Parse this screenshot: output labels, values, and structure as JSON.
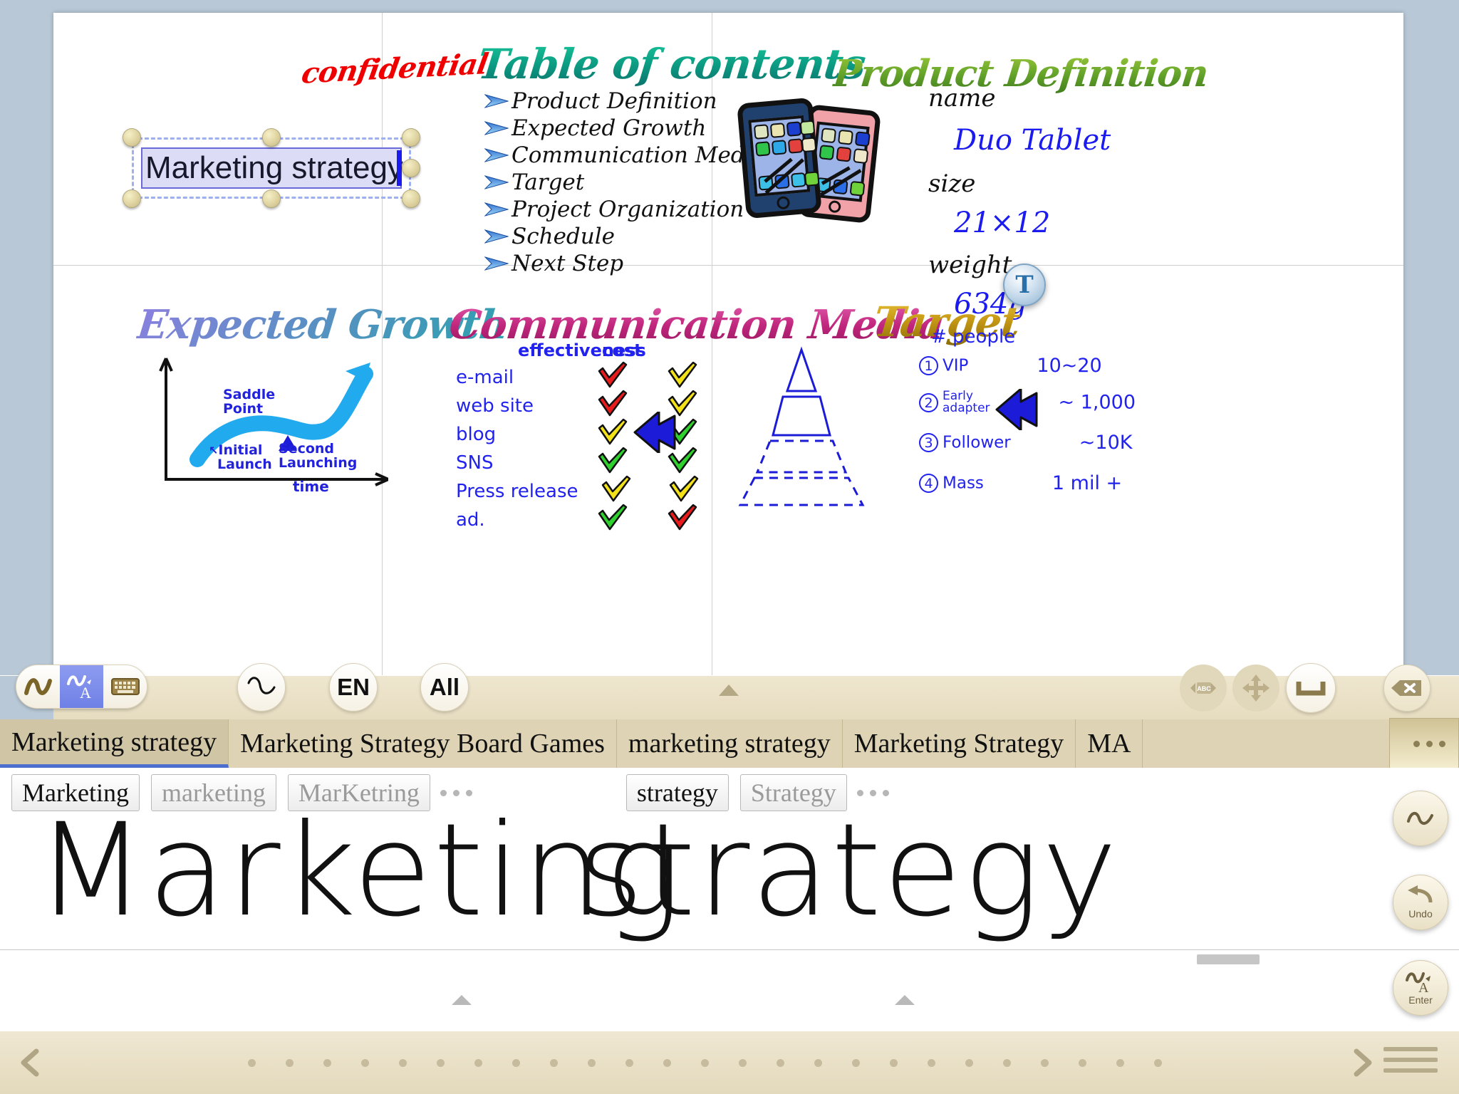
{
  "canvas": {
    "confidential_stamp": "confidential",
    "selected_title": "Marketing strategy",
    "panels": {
      "toc": {
        "title": "Table of contents",
        "items": [
          "Product Definition",
          "Expected Growth",
          "Communication Media",
          "Target",
          "Project Organization",
          "Schedule",
          "Next Step"
        ]
      },
      "product_definition": {
        "title": "Product Definition",
        "specs": [
          {
            "label": "name",
            "value": "Duo Tablet"
          },
          {
            "label": "size",
            "value": "21×12"
          },
          {
            "label": "weight",
            "value": "634g"
          }
        ]
      },
      "expected_growth": {
        "title": "Expected Growth",
        "y_label": "",
        "x_label": "time",
        "annotations": [
          "Saddle\nPoint",
          "Initial\nLaunch",
          "Second\nLaunching"
        ],
        "saddle_label": "Saddle",
        "saddle_label2": "Point",
        "initial_label": "Initial",
        "initial_label2": "Launch",
        "second_label": "Second",
        "second_label2": "Launching"
      },
      "communication_media": {
        "title": "Communication Media",
        "col_effectiveness": "effectiveness",
        "col_cost": "cost",
        "rows": [
          {
            "media": "e-mail",
            "effectiveness": "red",
            "cost": "yellow"
          },
          {
            "media": "web site",
            "effectiveness": "red",
            "cost": "yellow"
          },
          {
            "media": "blog",
            "effectiveness": "yellow",
            "cost": "green"
          },
          {
            "media": "SNS",
            "effectiveness": "green",
            "cost": "green"
          },
          {
            "media": "Press release",
            "effectiveness": "yellow",
            "cost": "yellow"
          },
          {
            "media": "ad.",
            "effectiveness": "green",
            "cost": "red"
          }
        ],
        "highlight_row_index": 3
      },
      "target": {
        "title": "Target",
        "column_header": "# people",
        "rows": [
          {
            "num": "1",
            "label": "VIP",
            "value": "10~20"
          },
          {
            "num": "2",
            "label": "Early adapter",
            "value": "~ 1,000"
          },
          {
            "num": "3",
            "label": "Follower",
            "value": "~10K"
          },
          {
            "num": "4",
            "label": "Mass",
            "value": "1 mil +"
          }
        ],
        "highlight_row_index": 1
      }
    },
    "text_tool_button": "T"
  },
  "ime_toolbar": {
    "mode_buttons": [
      {
        "icon": "handwriting-stroke-icon",
        "active": false
      },
      {
        "icon": "handwriting-to-text-icon",
        "active": true
      },
      {
        "icon": "keyboard-icon",
        "active": false
      }
    ],
    "stroke_button": "stroke-icon",
    "language_button": "EN",
    "scope_button": "All",
    "collapse_button": "chevron-up-icon",
    "abc_nav_button": "ABC",
    "move_button": "move-icon",
    "space_button": "space-icon",
    "delete_button": "delete-icon"
  },
  "candidates": {
    "row1": [
      {
        "label": "Marketing strategy",
        "selected": true
      },
      {
        "label": "Marketing Strategy Board Games",
        "selected": false
      },
      {
        "label": "marketing strategy",
        "selected": false
      },
      {
        "label": "Marketing Strategy",
        "selected": false
      },
      {
        "label": "MA",
        "selected": false
      }
    ],
    "more_button": "more-dots-icon",
    "row2_group1": [
      {
        "label": "Marketing",
        "dim": false
      },
      {
        "label": "marketing",
        "dim": true
      },
      {
        "label": "MarKetring",
        "dim": true
      }
    ],
    "row2_group2": [
      {
        "label": "strategy",
        "dim": false
      },
      {
        "label": "Strategy",
        "dim": true
      }
    ]
  },
  "ink_input": {
    "word1": "Marketing",
    "word2": "strategy"
  },
  "side_buttons": [
    {
      "name": "convert-button",
      "label": ""
    },
    {
      "name": "undo-button",
      "label": "Undo"
    },
    {
      "name": "enter-button",
      "label": "Enter"
    }
  ],
  "bottom_bar": {
    "prev_button": "chevron-left-icon",
    "next_button": "chevron-right-icon",
    "menu_button": "menu-icon"
  },
  "colors": {
    "accent_blue": "#2222ee",
    "stamp_red": "#ee0000",
    "toc_teal": "#0c9e84",
    "product_green": "#6aa82c",
    "growth_blue": "#5b8fc4",
    "media_magenta": "#c2277e",
    "target_gold": "#c79a16",
    "toolbar_tan": "#e6dcc0",
    "selection_lilac": "#dcdcf6"
  }
}
